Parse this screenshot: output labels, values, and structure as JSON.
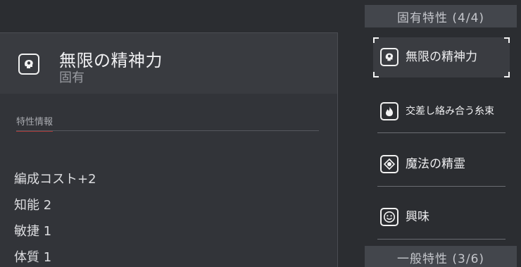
{
  "detail": {
    "title": "無限の精神力",
    "subtitle": "固有",
    "icon": "brain-head-icon",
    "section_label": "特性情報",
    "stats": [
      "編成コスト+2",
      "知能 2",
      "敏捷 1",
      "体質 1"
    ]
  },
  "traits": {
    "innate_header": "固有特性 (4/4)",
    "general_header": "一般特性 (3/6)",
    "items": [
      {
        "label": "無限の精神力",
        "icon": "brain-head-icon",
        "selected": true
      },
      {
        "label": "交差し絡み合う糸束",
        "icon": "flame-icon",
        "selected": false
      },
      {
        "label": "魔法の精霊",
        "icon": "spirit-orb-icon",
        "selected": false
      },
      {
        "label": "興味",
        "icon": "smiley-face-icon",
        "selected": false
      }
    ]
  },
  "colors": {
    "background": "#2b2d31",
    "panel": "#323439",
    "header_bar": "#43464c",
    "accent_underline": "#a63a3a"
  }
}
